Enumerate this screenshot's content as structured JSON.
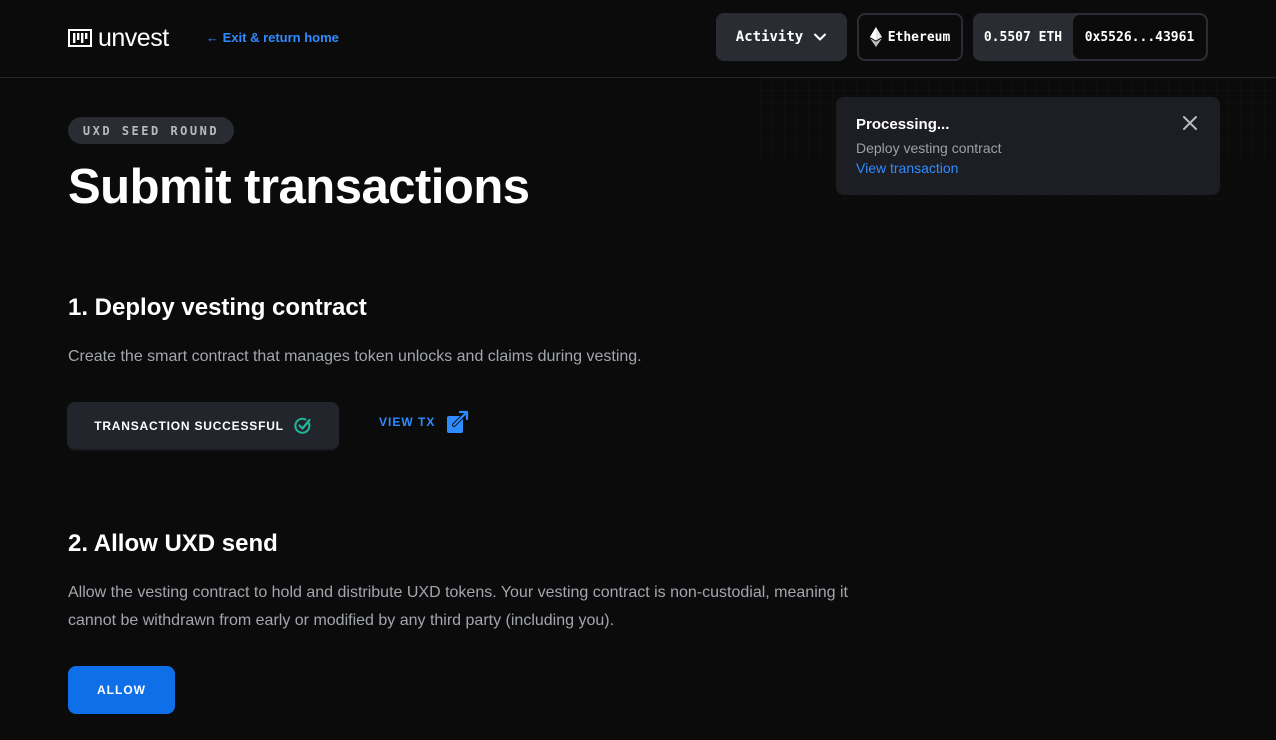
{
  "header": {
    "logo_text": "unvest",
    "exit_link": "← Exit & return home",
    "activity_label": "Activity",
    "network_label": "Ethereum",
    "balance": "0.5507 ETH",
    "address": "0x5526...43961"
  },
  "toast": {
    "title": "Processing...",
    "description": "Deploy vesting contract",
    "link": "View transaction"
  },
  "main": {
    "badge": "UXD SEED ROUND",
    "title": "Submit transactions",
    "steps": [
      {
        "title": "1. Deploy vesting contract",
        "description": "Create the smart contract that manages token unlocks and claims during vesting.",
        "status_label": "TRANSACTION SUCCESSFUL",
        "view_tx_label": "VIEW TX"
      },
      {
        "title": "2. Allow UXD send",
        "description": "Allow the vesting contract to hold and distribute UXD tokens. Your vesting contract is non-custodial, meaning it cannot be withdrawn from early or modified by any third party (including you).",
        "action_label": "ALLOW"
      }
    ]
  },
  "colors": {
    "background": "#0b0b0c",
    "accent": "#0f6fe8",
    "link": "#2f8bff",
    "success": "#1fb89a"
  },
  "icons": [
    "unvest-logo-icon",
    "chevron-down-icon",
    "ethereum-icon",
    "close-icon",
    "check-badge-icon",
    "external-link-icon"
  ]
}
